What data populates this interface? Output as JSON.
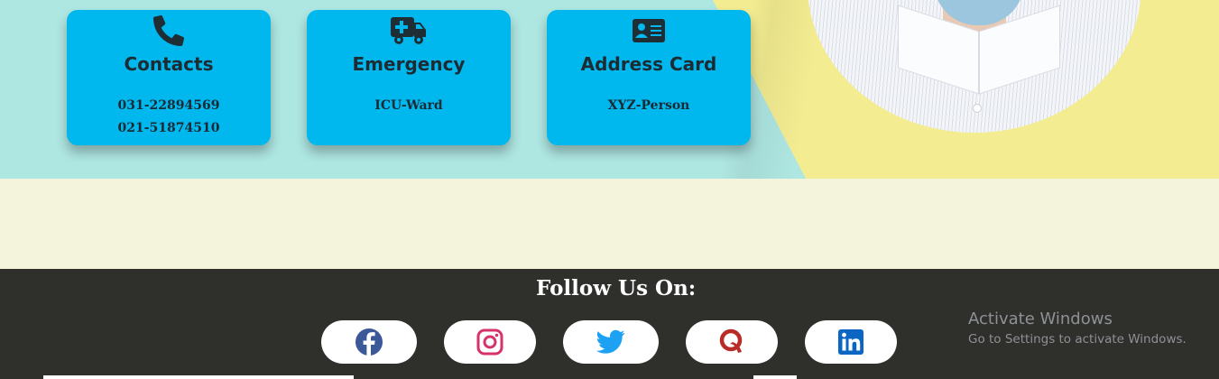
{
  "cards": [
    {
      "icon": "phone-icon",
      "title": "Contacts",
      "lines": [
        "031-22894569",
        "021-51874510"
      ]
    },
    {
      "icon": "ambulance-icon",
      "title": "Emergency",
      "lines": [
        "ICU-Ward"
      ]
    },
    {
      "icon": "address-card-icon",
      "title": "Address Card",
      "lines": [
        "XYZ-Person"
      ]
    }
  ],
  "footer": {
    "heading": "Follow Us On:",
    "social": [
      {
        "name": "facebook-icon",
        "color": "#3b5998"
      },
      {
        "name": "instagram-icon",
        "color": "#d6336c"
      },
      {
        "name": "twitter-icon",
        "color": "#1da1f2"
      },
      {
        "name": "quora-icon",
        "color": "#b92b27"
      },
      {
        "name": "linkedin-icon",
        "color": "#0a66c2"
      }
    ]
  },
  "watermark": {
    "title": "Activate Windows",
    "subtitle": "Go to Settings to activate Windows."
  },
  "colors": {
    "card_bg": "#00b7ee",
    "hero_teal": "#aee6e2",
    "hero_yellow": "#f3ec91",
    "middle_bg": "#f4f4dc",
    "footer_bg": "#2f2f2b"
  }
}
